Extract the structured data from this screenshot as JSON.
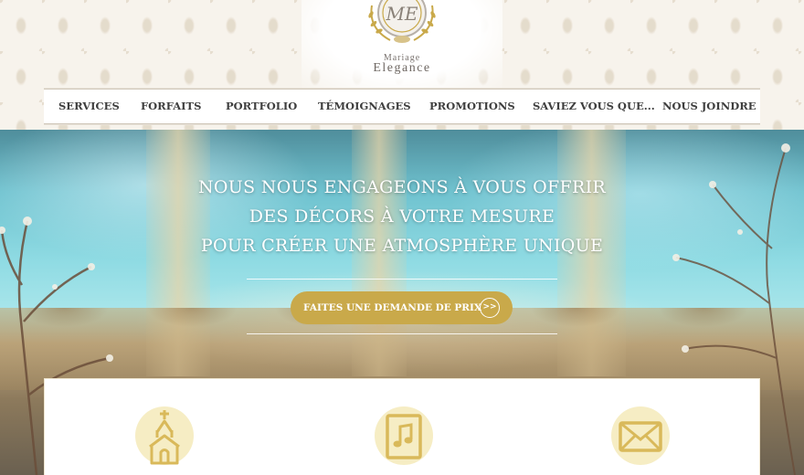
{
  "brand": {
    "line1": "Mariage",
    "line2": "Elegance",
    "monogram_icon": "monogram-emblem-icon"
  },
  "nav": {
    "items": [
      {
        "label": "SERVICES"
      },
      {
        "label": "FORFAITS"
      },
      {
        "label": "PORTFOLIO"
      },
      {
        "label": "TÉMOIGNAGES"
      },
      {
        "label": "PROMOTIONS"
      },
      {
        "label": "SAVIEZ VOUS QUE..."
      },
      {
        "label": "NOUS JOINDRE"
      }
    ]
  },
  "hero": {
    "lines": [
      "NOUS NOUS ENGAGEONS À VOUS OFFRIR",
      "DES DÉCORS À VOTRE MESURE",
      "POUR CRÉER UNE ATMOSPHÈRE UNIQUE"
    ],
    "cta_label": "FAITES UNE DEMANDE DE PRIX",
    "cta_arrow": ">>"
  },
  "services": {
    "icons": [
      "chapel-icon",
      "music-note-icon",
      "envelope-icon"
    ]
  },
  "colors": {
    "gold": "#c9a94a",
    "icon_bg": "#f6edc4",
    "icon_fg": "#d9b95a",
    "nav_text": "#3e3e3e"
  }
}
